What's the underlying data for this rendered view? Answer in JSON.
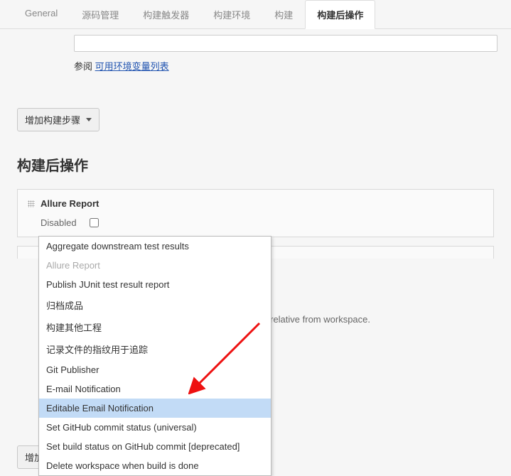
{
  "tabs": {
    "general": "General",
    "scm": "源码管理",
    "triggers": "构建触发器",
    "env": "构建环境",
    "build": "构建",
    "postbuild": "构建后操作"
  },
  "refer": {
    "prefix": "参阅 ",
    "link": "可用环境变量列表"
  },
  "buttons": {
    "addBuildStep": "增加构建步骤",
    "addPostBuildStep": "增加构建后操作步骤"
  },
  "section": {
    "postBuildTitle": "构建后操作"
  },
  "allurePanel": {
    "title": "Allure Report",
    "disabledLabel": "Disabled"
  },
  "hintVisible": "s relative from workspace.",
  "menu": {
    "items": [
      {
        "label": "Aggregate downstream test results",
        "state": "normal"
      },
      {
        "label": "Allure Report",
        "state": "disabled"
      },
      {
        "label": "Publish JUnit test result report",
        "state": "normal"
      },
      {
        "label": "归档成品",
        "state": "normal"
      },
      {
        "label": "构建其他工程",
        "state": "normal"
      },
      {
        "label": "记录文件的指纹用于追踪",
        "state": "normal"
      },
      {
        "label": "Git Publisher",
        "state": "normal"
      },
      {
        "label": "E-mail Notification",
        "state": "normal"
      },
      {
        "label": "Editable Email Notification",
        "state": "highlighted"
      },
      {
        "label": "Set GitHub commit status (universal)",
        "state": "normal"
      },
      {
        "label": "Set build status on GitHub commit [deprecated]",
        "state": "normal"
      },
      {
        "label": "Delete workspace when build is done",
        "state": "normal"
      }
    ]
  }
}
